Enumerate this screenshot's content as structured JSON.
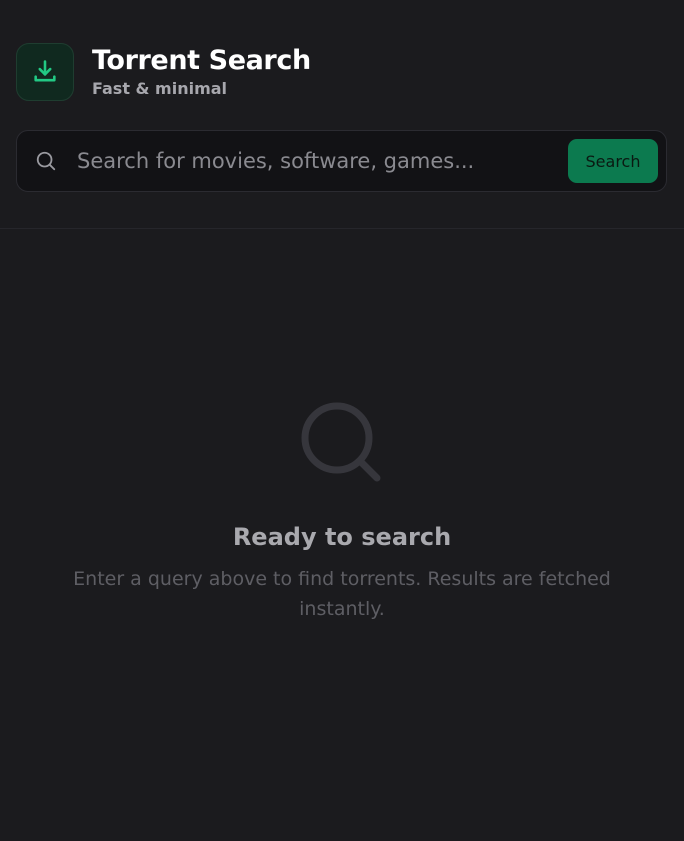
{
  "header": {
    "title": "Torrent Search",
    "subtitle": "Fast & minimal",
    "app_icon": "download-icon"
  },
  "search": {
    "placeholder": "Search for movies, software, games...",
    "value": "",
    "button_label": "Search",
    "icon": "search-icon"
  },
  "empty_state": {
    "icon": "search-icon",
    "title": "Ready to search",
    "description": "Enter a query above to find torrents. Results are fetched instantly."
  },
  "colors": {
    "background": "#1b1b1e",
    "accent": "#0c7a4f",
    "accent_icon": "#22c984"
  }
}
